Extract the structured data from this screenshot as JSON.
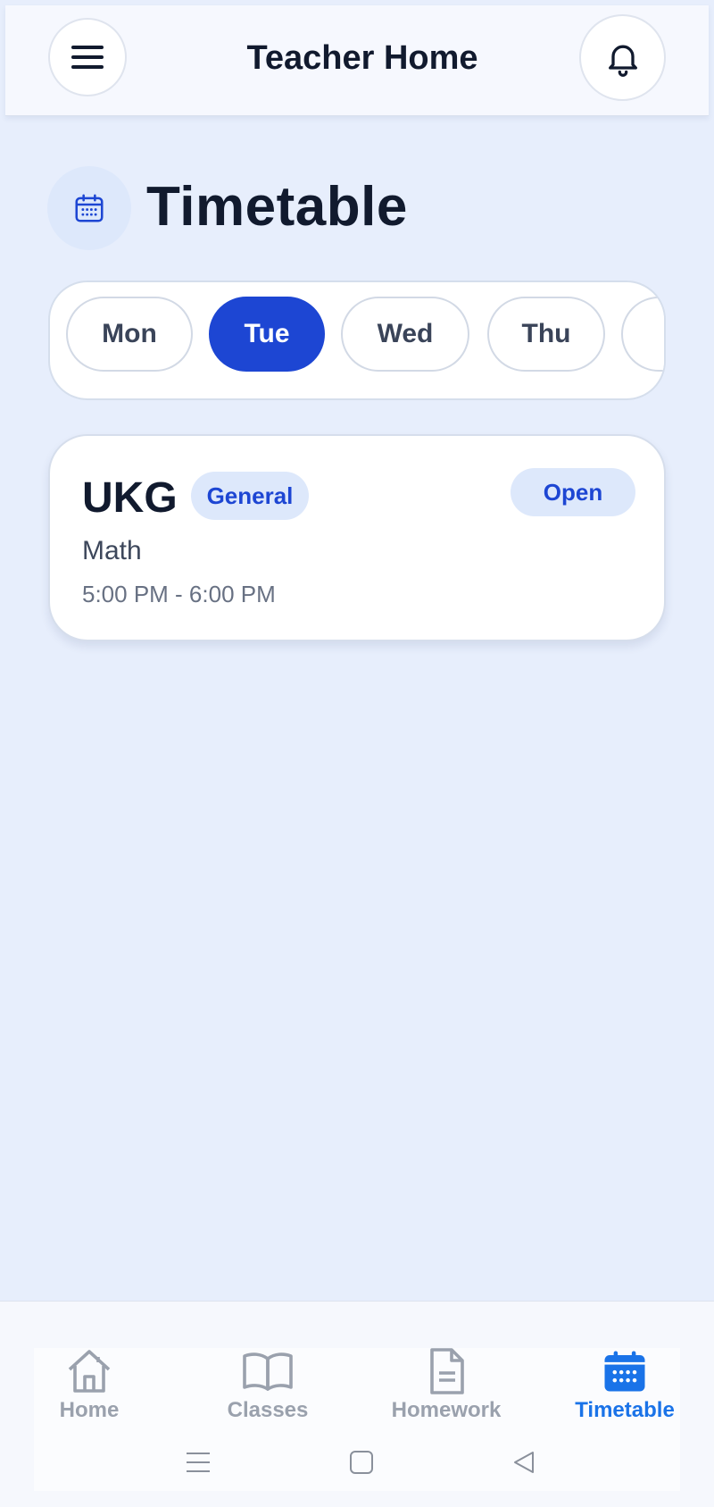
{
  "header": {
    "title": "Teacher Home",
    "menu_icon": "hamburger-menu-icon",
    "bell_icon": "bell-icon"
  },
  "page": {
    "title": "Timetable",
    "title_icon": "calendar-icon"
  },
  "days": {
    "selected": "Tue",
    "items": [
      {
        "label": "Mon"
      },
      {
        "label": "Tue"
      },
      {
        "label": "Wed"
      },
      {
        "label": "Thu"
      },
      {
        "label": ""
      }
    ]
  },
  "class_card": {
    "class_name": "UKG",
    "section": "General",
    "open_label": "Open",
    "subject": "Math",
    "time": "5:00 PM - 6:00 PM"
  },
  "bottom_nav": {
    "items": [
      {
        "label": "Home",
        "icon": "home-icon"
      },
      {
        "label": "Classes",
        "icon": "book-open-icon"
      },
      {
        "label": "Homework",
        "icon": "document-icon"
      },
      {
        "label": "Timetable",
        "icon": "calendar-icon"
      }
    ],
    "active": "Timetable"
  },
  "colors": {
    "background": "#e7eefc",
    "accent": "#1d46d3",
    "nav_active": "#1a73e8",
    "nav_inactive": "#9aa1ad",
    "badge_bg": "#dde8fb"
  },
  "system_bar": {
    "icons": [
      "recent-apps-icon",
      "home-square-icon",
      "back-triangle-icon"
    ]
  }
}
